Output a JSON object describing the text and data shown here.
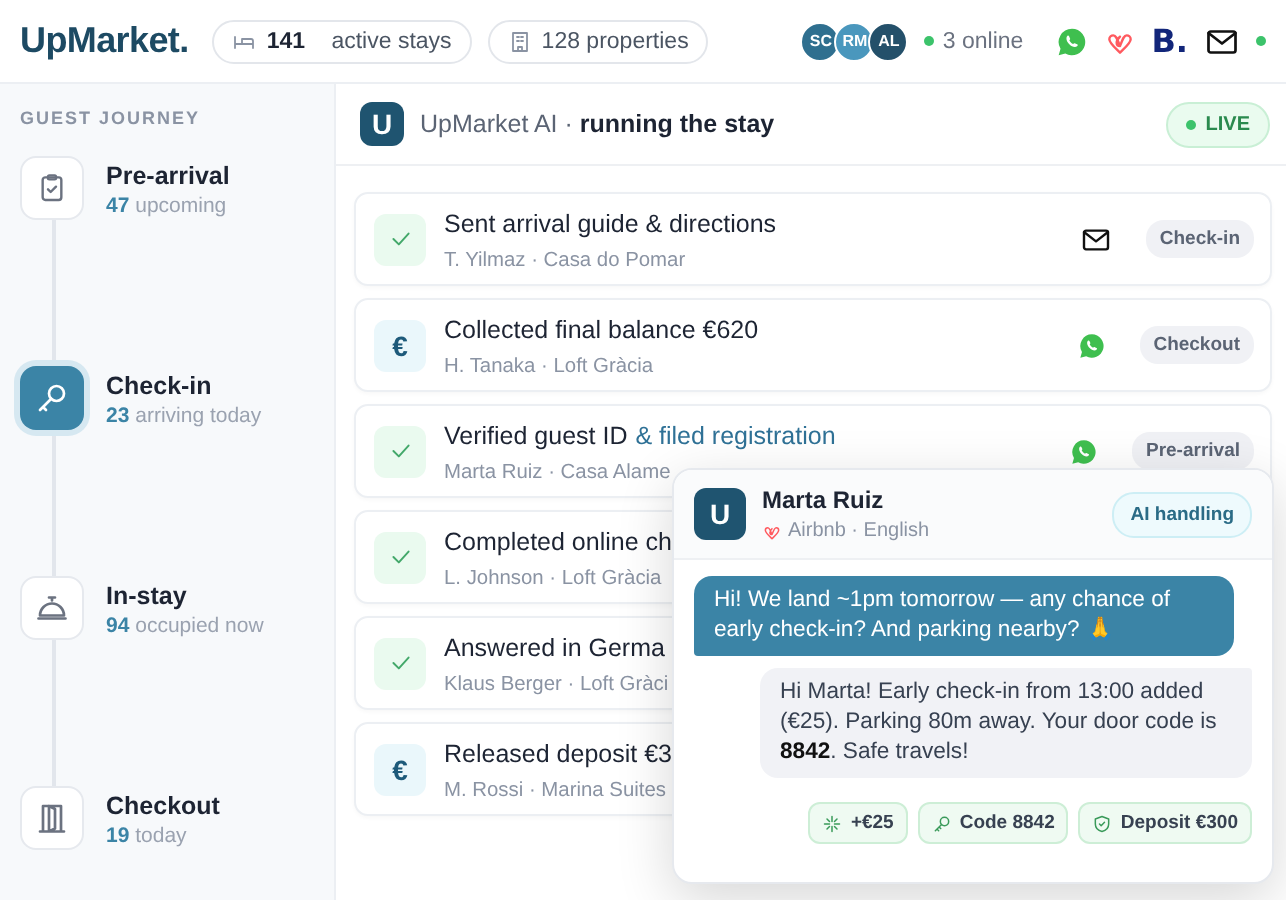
{
  "header": {
    "logo": "UpMarket.",
    "stats": [
      {
        "kind": "stays",
        "count": "141",
        "label": "active stays"
      },
      {
        "kind": "properties",
        "label": "128 properties"
      }
    ],
    "avatars": [
      {
        "initials": "SC",
        "color": "#2f6f8f"
      },
      {
        "initials": "RM",
        "color": "#4a97bd"
      },
      {
        "initials": "AL",
        "color": "#24506a"
      }
    ],
    "online": "3 online",
    "channels": [
      {
        "kind": "whatsapp"
      },
      {
        "kind": "airbnb"
      },
      {
        "kind": "booking",
        "text": "B."
      },
      {
        "kind": "email"
      }
    ]
  },
  "sidebar": {
    "heading": "GUEST JOURNEY",
    "stages": [
      {
        "kind": "clipboard",
        "title": "Pre-arrival",
        "count": "47",
        "detail": "upcoming",
        "selected": false
      },
      {
        "kind": "key",
        "title": "Check-in",
        "count": "23",
        "detail": "arriving today",
        "selected": true
      },
      {
        "kind": "bell",
        "title": "In-stay",
        "count": "94",
        "detail": "occupied now",
        "selected": false
      },
      {
        "kind": "door",
        "title": "Checkout",
        "count": "19",
        "detail": "today",
        "selected": false
      }
    ]
  },
  "feed": {
    "logo": "U",
    "title": "UpMarket AI · **running the stay**",
    "status": "LIVE",
    "items": [
      {
        "kind": "check",
        "title": "Sent arrival guide & directions",
        "subtitle": "T. Yilmaz · Casa do Pomar",
        "channel": {
          "kind": "email"
        },
        "tag": "Check-in"
      },
      {
        "kind": "euro",
        "symbol": "€",
        "title": "Collected final balance €620",
        "subtitle": "H. Tanaka · Loft Gràcia",
        "channel": {
          "kind": "whatsapp"
        },
        "tag": "Checkout"
      },
      {
        "kind": "check",
        "title": "Verified guest ID",
        "highlight": "& filed registration",
        "subtitle": "Marta Ruiz · Casa Alame",
        "channel": {
          "kind": "whatsapp"
        },
        "tag": "Pre-arrival"
      },
      {
        "kind": "check",
        "title": "Completed online ch",
        "subtitle": "L. Johnson · Loft Gràcia"
      },
      {
        "kind": "check",
        "title": "Answered in Germa",
        "subtitle": "Klaus Berger · Loft Gràci"
      },
      {
        "kind": "euro",
        "symbol": "€",
        "title": "Released deposit €3",
        "subtitle": "M. Rossi · Marina Suites"
      }
    ]
  },
  "chat": {
    "logo": "U",
    "name": "Marta Ruiz",
    "source": "Airbnb · English",
    "badge": "AI handling",
    "messages": [
      {
        "kind": "guest",
        "text": "Hi! We land ~1pm tomorrow — any chance of early check-in? And parking nearby? 🙏"
      },
      {
        "kind": "ai",
        "text": "Hi Marta! Early check-in from 13:00 added (€25). Parking 80m away. Your door code is **8842**. Safe travels!"
      }
    ],
    "actions": [
      {
        "kind": "upsell",
        "label": "+€25"
      },
      {
        "kind": "code",
        "label": "Code 8842"
      },
      {
        "kind": "deposit",
        "label": "Deposit €300"
      }
    ]
  }
}
